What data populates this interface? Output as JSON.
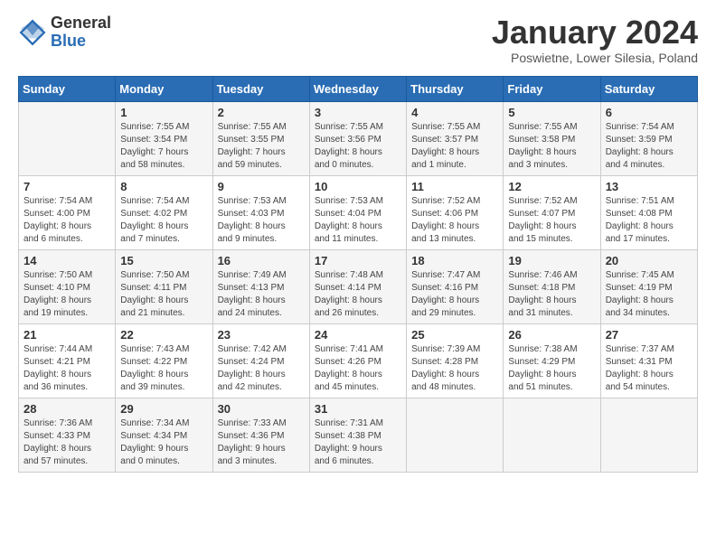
{
  "logo": {
    "general": "General",
    "blue": "Blue"
  },
  "title": "January 2024",
  "subtitle": "Poswietne, Lower Silesia, Poland",
  "headers": [
    "Sunday",
    "Monday",
    "Tuesday",
    "Wednesday",
    "Thursday",
    "Friday",
    "Saturday"
  ],
  "weeks": [
    [
      {
        "day": "",
        "content": ""
      },
      {
        "day": "1",
        "content": "Sunrise: 7:55 AM\nSunset: 3:54 PM\nDaylight: 7 hours\nand 58 minutes."
      },
      {
        "day": "2",
        "content": "Sunrise: 7:55 AM\nSunset: 3:55 PM\nDaylight: 7 hours\nand 59 minutes."
      },
      {
        "day": "3",
        "content": "Sunrise: 7:55 AM\nSunset: 3:56 PM\nDaylight: 8 hours\nand 0 minutes."
      },
      {
        "day": "4",
        "content": "Sunrise: 7:55 AM\nSunset: 3:57 PM\nDaylight: 8 hours\nand 1 minute."
      },
      {
        "day": "5",
        "content": "Sunrise: 7:55 AM\nSunset: 3:58 PM\nDaylight: 8 hours\nand 3 minutes."
      },
      {
        "day": "6",
        "content": "Sunrise: 7:54 AM\nSunset: 3:59 PM\nDaylight: 8 hours\nand 4 minutes."
      }
    ],
    [
      {
        "day": "7",
        "content": "Sunrise: 7:54 AM\nSunset: 4:00 PM\nDaylight: 8 hours\nand 6 minutes."
      },
      {
        "day": "8",
        "content": "Sunrise: 7:54 AM\nSunset: 4:02 PM\nDaylight: 8 hours\nand 7 minutes."
      },
      {
        "day": "9",
        "content": "Sunrise: 7:53 AM\nSunset: 4:03 PM\nDaylight: 8 hours\nand 9 minutes."
      },
      {
        "day": "10",
        "content": "Sunrise: 7:53 AM\nSunset: 4:04 PM\nDaylight: 8 hours\nand 11 minutes."
      },
      {
        "day": "11",
        "content": "Sunrise: 7:52 AM\nSunset: 4:06 PM\nDaylight: 8 hours\nand 13 minutes."
      },
      {
        "day": "12",
        "content": "Sunrise: 7:52 AM\nSunset: 4:07 PM\nDaylight: 8 hours\nand 15 minutes."
      },
      {
        "day": "13",
        "content": "Sunrise: 7:51 AM\nSunset: 4:08 PM\nDaylight: 8 hours\nand 17 minutes."
      }
    ],
    [
      {
        "day": "14",
        "content": "Sunrise: 7:50 AM\nSunset: 4:10 PM\nDaylight: 8 hours\nand 19 minutes."
      },
      {
        "day": "15",
        "content": "Sunrise: 7:50 AM\nSunset: 4:11 PM\nDaylight: 8 hours\nand 21 minutes."
      },
      {
        "day": "16",
        "content": "Sunrise: 7:49 AM\nSunset: 4:13 PM\nDaylight: 8 hours\nand 24 minutes."
      },
      {
        "day": "17",
        "content": "Sunrise: 7:48 AM\nSunset: 4:14 PM\nDaylight: 8 hours\nand 26 minutes."
      },
      {
        "day": "18",
        "content": "Sunrise: 7:47 AM\nSunset: 4:16 PM\nDaylight: 8 hours\nand 29 minutes."
      },
      {
        "day": "19",
        "content": "Sunrise: 7:46 AM\nSunset: 4:18 PM\nDaylight: 8 hours\nand 31 minutes."
      },
      {
        "day": "20",
        "content": "Sunrise: 7:45 AM\nSunset: 4:19 PM\nDaylight: 8 hours\nand 34 minutes."
      }
    ],
    [
      {
        "day": "21",
        "content": "Sunrise: 7:44 AM\nSunset: 4:21 PM\nDaylight: 8 hours\nand 36 minutes."
      },
      {
        "day": "22",
        "content": "Sunrise: 7:43 AM\nSunset: 4:22 PM\nDaylight: 8 hours\nand 39 minutes."
      },
      {
        "day": "23",
        "content": "Sunrise: 7:42 AM\nSunset: 4:24 PM\nDaylight: 8 hours\nand 42 minutes."
      },
      {
        "day": "24",
        "content": "Sunrise: 7:41 AM\nSunset: 4:26 PM\nDaylight: 8 hours\nand 45 minutes."
      },
      {
        "day": "25",
        "content": "Sunrise: 7:39 AM\nSunset: 4:28 PM\nDaylight: 8 hours\nand 48 minutes."
      },
      {
        "day": "26",
        "content": "Sunrise: 7:38 AM\nSunset: 4:29 PM\nDaylight: 8 hours\nand 51 minutes."
      },
      {
        "day": "27",
        "content": "Sunrise: 7:37 AM\nSunset: 4:31 PM\nDaylight: 8 hours\nand 54 minutes."
      }
    ],
    [
      {
        "day": "28",
        "content": "Sunrise: 7:36 AM\nSunset: 4:33 PM\nDaylight: 8 hours\nand 57 minutes."
      },
      {
        "day": "29",
        "content": "Sunrise: 7:34 AM\nSunset: 4:34 PM\nDaylight: 9 hours\nand 0 minutes."
      },
      {
        "day": "30",
        "content": "Sunrise: 7:33 AM\nSunset: 4:36 PM\nDaylight: 9 hours\nand 3 minutes."
      },
      {
        "day": "31",
        "content": "Sunrise: 7:31 AM\nSunset: 4:38 PM\nDaylight: 9 hours\nand 6 minutes."
      },
      {
        "day": "",
        "content": ""
      },
      {
        "day": "",
        "content": ""
      },
      {
        "day": "",
        "content": ""
      }
    ]
  ]
}
